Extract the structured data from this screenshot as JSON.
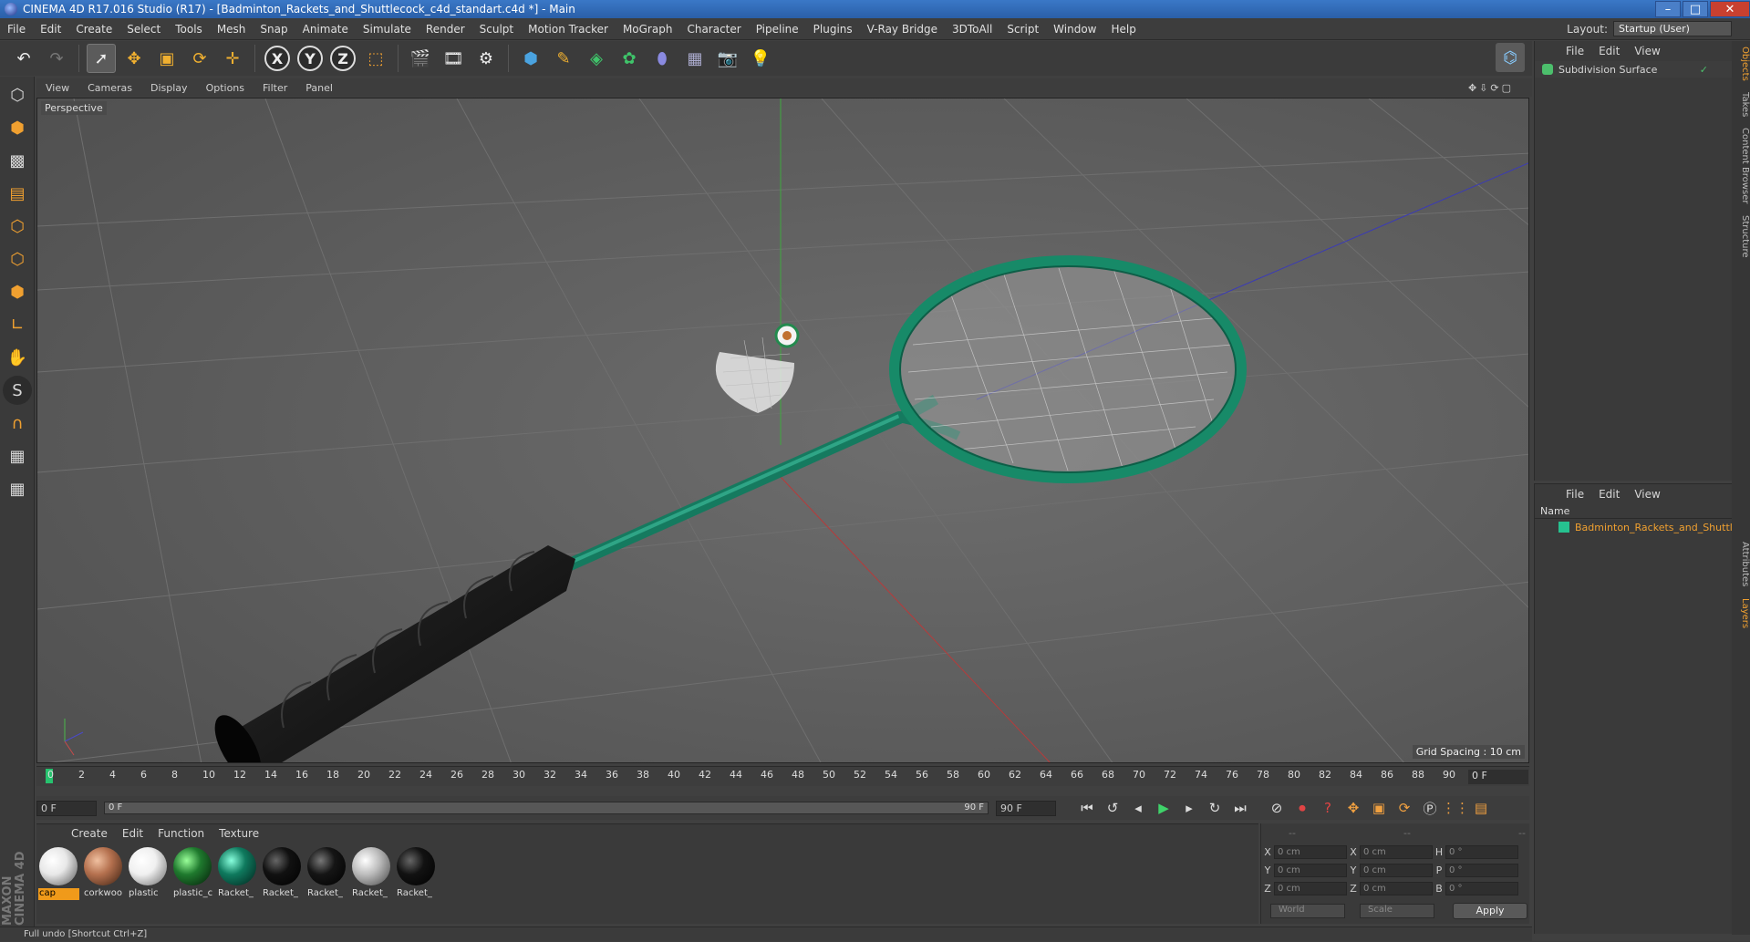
{
  "app": {
    "title": "CINEMA 4D R17.016 Studio (R17) - [Badminton_Rackets_and_Shuttlecock_c4d_standart.c4d *] - Main",
    "win_minimize": "–",
    "win_maximize": "□",
    "win_close": "✕"
  },
  "menu": {
    "items": [
      "File",
      "Edit",
      "Create",
      "Select",
      "Tools",
      "Mesh",
      "Snap",
      "Animate",
      "Simulate",
      "Render",
      "Sculpt",
      "Motion Tracker",
      "MoGraph",
      "Character",
      "Pipeline",
      "Plugins",
      "V-Ray Bridge",
      "3DToAll",
      "Script",
      "Window",
      "Help"
    ],
    "layout_label": "Layout:",
    "layout_value": "Startup (User)"
  },
  "toolbar": {
    "axis_x": "X",
    "axis_y": "Y",
    "axis_z": "Z",
    "icons": [
      "undo-icon",
      "redo-icon",
      "select-icon",
      "move-icon",
      "scale-icon",
      "rotate-icon",
      "live-select-icon",
      "coordinate-icon",
      "render-view-icon",
      "render-picture-viewer-icon",
      "edit-render-settings-icon",
      "cube-icon",
      "pen-icon",
      "subdivision-icon",
      "mograph-cloner-icon",
      "deformer-icon",
      "floor-icon",
      "camera-icon",
      "light-icon",
      "python-icon"
    ]
  },
  "viewport": {
    "menu": [
      "View",
      "Cameras",
      "Display",
      "Options",
      "Filter",
      "Panel"
    ],
    "label": "Perspective",
    "grid_spacing": "Grid Spacing : 10 cm"
  },
  "timeline": {
    "ticks": [
      "0",
      "2",
      "4",
      "6",
      "8",
      "10",
      "12",
      "14",
      "16",
      "18",
      "20",
      "22",
      "24",
      "26",
      "28",
      "30",
      "32",
      "34",
      "36",
      "38",
      "40",
      "42",
      "44",
      "46",
      "48",
      "50",
      "52",
      "54",
      "56",
      "58",
      "60",
      "62",
      "64",
      "66",
      "68",
      "70",
      "72",
      "74",
      "76",
      "78",
      "80",
      "82",
      "84",
      "86",
      "88",
      "90"
    ],
    "current_frame": "0 F"
  },
  "transport": {
    "start": "0 F",
    "range_start": "0 F",
    "range_end": "90 F",
    "end": "90 F"
  },
  "materials": {
    "menu": [
      "Create",
      "Edit",
      "Function",
      "Texture"
    ],
    "items": [
      {
        "label": "cap",
        "color": "#e8e8e8",
        "selected": true
      },
      {
        "label": "corkwoo",
        "color": "#b5714f",
        "selected": false
      },
      {
        "label": "plastic",
        "color": "#f0f0f0",
        "selected": false
      },
      {
        "label": "plastic_c",
        "color": "#1f7a2e",
        "selected": false
      },
      {
        "label": "Racket_",
        "color": "#0f7a5e",
        "selected": false
      },
      {
        "label": "Racket_",
        "color": "#111111",
        "selected": false
      },
      {
        "label": "Racket_",
        "color": "#151515",
        "selected": false
      },
      {
        "label": "Racket_",
        "color": "#bdbdbd",
        "selected": false
      },
      {
        "label": "Racket_",
        "color": "#121212",
        "selected": false
      }
    ]
  },
  "coordinates": {
    "header": [
      "--",
      "--",
      "--"
    ],
    "rows": [
      {
        "l1": "X",
        "v1": "0 cm",
        "l2": "X",
        "v2": "0 cm",
        "l3": "H",
        "v3": "0 °"
      },
      {
        "l1": "Y",
        "v1": "0 cm",
        "l2": "Y",
        "v2": "0 cm",
        "l3": "P",
        "v3": "0 °"
      },
      {
        "l1": "Z",
        "v1": "0 cm",
        "l2": "Z",
        "v2": "0 cm",
        "l3": "B",
        "v3": "0 °"
      }
    ],
    "world": "World",
    "scale": "Scale",
    "apply": "Apply"
  },
  "objects": {
    "menu": [
      "File",
      "Edit",
      "View"
    ],
    "item": "Subdivision Surface"
  },
  "layers": {
    "menu": [
      "File",
      "Edit",
      "View"
    ],
    "col_name": "Name",
    "item": "Badminton_Rackets_and_Shuttlecock"
  },
  "side_tabs": [
    "Objects",
    "Takes",
    "Content Browser",
    "Structure",
    "Attributes",
    "Layers"
  ],
  "brand": "MAXON CINEMA 4D",
  "status": "Full undo [Shortcut Ctrl+Z]"
}
